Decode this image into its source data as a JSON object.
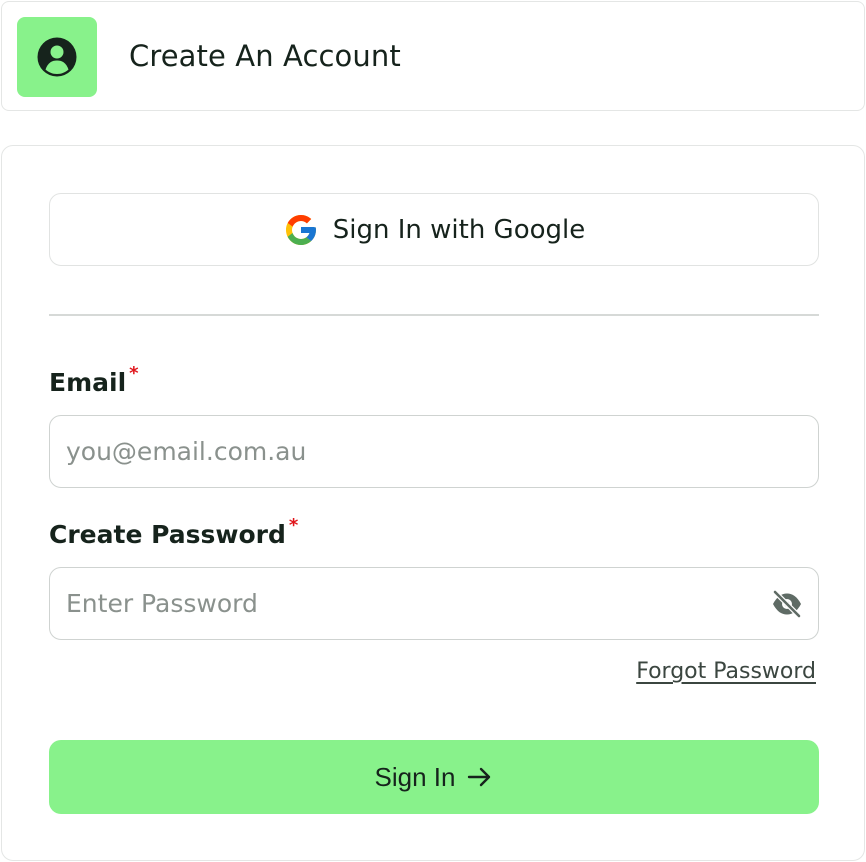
{
  "header": {
    "title": "Create An Account",
    "icon": "user-circle-icon",
    "accent_color": "#88f28b"
  },
  "form": {
    "google_button_label": "Sign In with Google",
    "google_icon": "google-g-icon",
    "email": {
      "label": "Email",
      "required_marker": "*",
      "placeholder": "you@email.com.au",
      "value": ""
    },
    "password": {
      "label": "Create Password",
      "required_marker": "*",
      "placeholder": "Enter Password",
      "value": "",
      "toggle_icon": "eye-off-icon"
    },
    "forgot_password_label": "Forgot Password",
    "submit_label": "Sign In",
    "submit_icon": "arrow-right-icon",
    "required_color": "#e0161c"
  }
}
